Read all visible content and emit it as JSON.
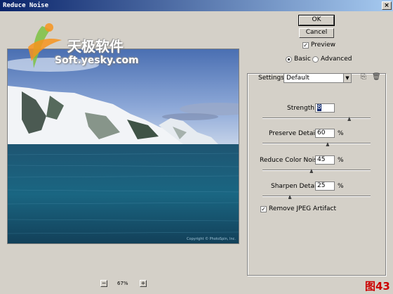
{
  "window": {
    "title": "Reduce Noise",
    "close_glyph": "×"
  },
  "watermark": {
    "brand_cn": "天极软件",
    "brand_en": "Soft.yesky.com"
  },
  "preview": {
    "copyright": "Copyright © PhotoSpin, Inc."
  },
  "buttons": {
    "ok": "OK",
    "cancel": "Cancel"
  },
  "options": {
    "preview_label": "Preview",
    "preview_checked": true,
    "mode_basic": "Basic",
    "mode_advanced": "Advanced",
    "mode_selected": "Basic"
  },
  "settings": {
    "label": "Settings:",
    "value": "Default",
    "icons": [
      "save-icon",
      "trash-icon"
    ]
  },
  "sliders": [
    {
      "label": "Strength:",
      "value": "8",
      "unit": "",
      "max": 10,
      "fraction": 0.8
    },
    {
      "label": "Preserve Details:",
      "value": "60",
      "unit": "%",
      "fraction": 0.6
    },
    {
      "label": "Reduce Color Noise:",
      "value": "45",
      "unit": "%",
      "fraction": 0.45
    },
    {
      "label": "Sharpen Details:",
      "value": "25",
      "unit": "%",
      "fraction": 0.25
    }
  ],
  "jpeg": {
    "label": "Remove JPEG Artifact",
    "checked": true
  },
  "zoom": {
    "minus": "−",
    "level": "67%",
    "plus": "+"
  },
  "figure_label": "图43"
}
